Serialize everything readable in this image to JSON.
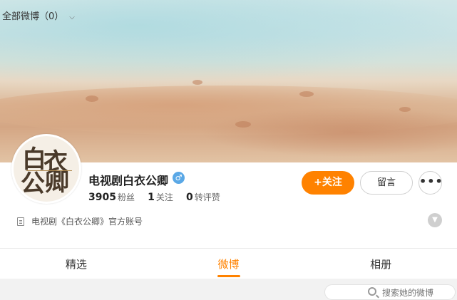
{
  "profile": {
    "name": "电视剧白衣公卿",
    "verified_icon": "verified-male-badge",
    "avatar_text": [
      "白",
      "衣",
      "公",
      "卿"
    ],
    "stats": [
      {
        "value": "3905",
        "label": "粉丝"
      },
      {
        "value": "1",
        "label": "关注"
      },
      {
        "value": "0",
        "label": "转评赞"
      }
    ],
    "description": "电视剧《白衣公卿》官方账号"
  },
  "actions": {
    "follow_label": "+关注",
    "message_label": "留言",
    "more_label": "•••"
  },
  "tabs": [
    {
      "label": "精选",
      "active": false
    },
    {
      "label": "微博",
      "active": true
    },
    {
      "label": "相册",
      "active": false
    }
  ],
  "filter": {
    "label": "全部微博（0）",
    "search_placeholder": "搜索她的微博"
  },
  "colors": {
    "accent": "#ff8200",
    "verified": "#5aa8e6"
  }
}
